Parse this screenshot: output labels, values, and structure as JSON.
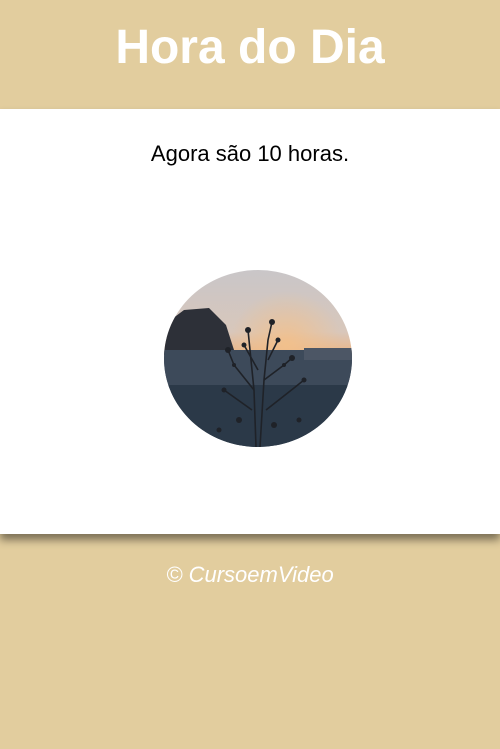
{
  "header": {
    "title": "Hora do Dia"
  },
  "main": {
    "message": "Agora são 10 horas."
  },
  "footer": {
    "copyright": "© CursoemVideo"
  },
  "colors": {
    "background": "#e2cd9e",
    "title": "#ffffff",
    "card": "#ffffff"
  }
}
